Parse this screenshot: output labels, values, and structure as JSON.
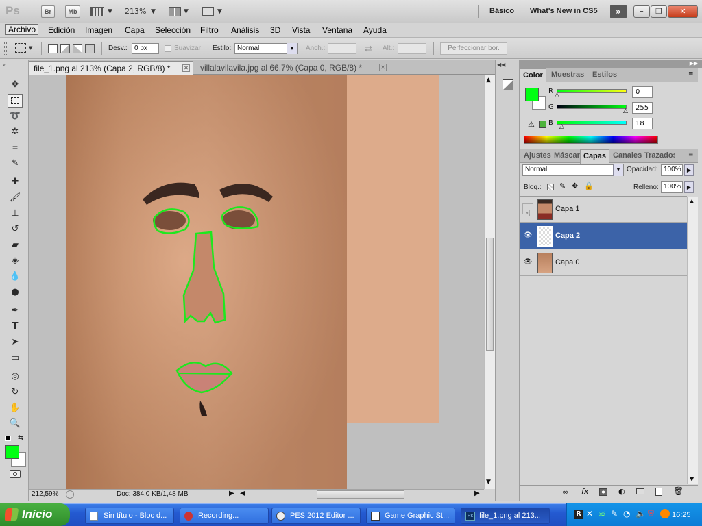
{
  "app": {
    "logo": "Ps",
    "bridge_label": "Br",
    "minibridge_label": "Mb",
    "zoom": "213%",
    "workspace_basic": "Básico",
    "workspace_new": "What's New in CS5"
  },
  "menu": [
    "Archivo",
    "Edición",
    "Imagen",
    "Capa",
    "Selección",
    "Filtro",
    "Análisis",
    "3D",
    "Vista",
    "Ventana",
    "Ayuda"
  ],
  "options": {
    "feather_label": "Desv.:",
    "feather_value": "0 px",
    "smooth_label": "Suavizar",
    "style_label": "Estilo:",
    "style_value": "Normal",
    "width_label": "Anch.:",
    "height_label": "Alt.:",
    "refine_label": "Perfeccionar bor."
  },
  "tabs": [
    {
      "label": "file_1.png al 213% (Capa 2, RGB/8) *"
    },
    {
      "label": "villalavilavila.jpg al 66,7% (Capa 0, RGB/8) *"
    }
  ],
  "status": {
    "zoom": "212,59%",
    "doc": "Doc: 384,0 KB/1,48 MB"
  },
  "color_panel": {
    "tabs": [
      "Color",
      "Muestras",
      "Estilos"
    ],
    "r_label": "R",
    "r_value": "0",
    "g_label": "G",
    "g_value": "255",
    "b_label": "B",
    "b_value": "18",
    "foreground": "#00ff12"
  },
  "layers_panel": {
    "tabs": [
      "Ajustes",
      "Máscaras",
      "Capas",
      "Canales",
      "Trazados"
    ],
    "blend_mode": "Normal",
    "opacity_label": "Opacidad:",
    "opacity_value": "100%",
    "lock_label": "Bloq.:",
    "fill_label": "Relleno:",
    "fill_value": "100%",
    "layers": [
      {
        "name": "Capa 1",
        "visible": false,
        "selected": false
      },
      {
        "name": "Capa 2",
        "visible": true,
        "selected": true
      },
      {
        "name": "Capa 0",
        "visible": true,
        "selected": false
      }
    ]
  },
  "taskbar": {
    "start": "Inicio",
    "tasks": [
      {
        "label": "Sin título - Bloc d..."
      },
      {
        "label": "Recording..."
      },
      {
        "label": "PES 2012 Editor ..."
      },
      {
        "label": "Game Graphic St..."
      },
      {
        "label": "file_1.png al 213..."
      }
    ],
    "clock": "16:25"
  }
}
